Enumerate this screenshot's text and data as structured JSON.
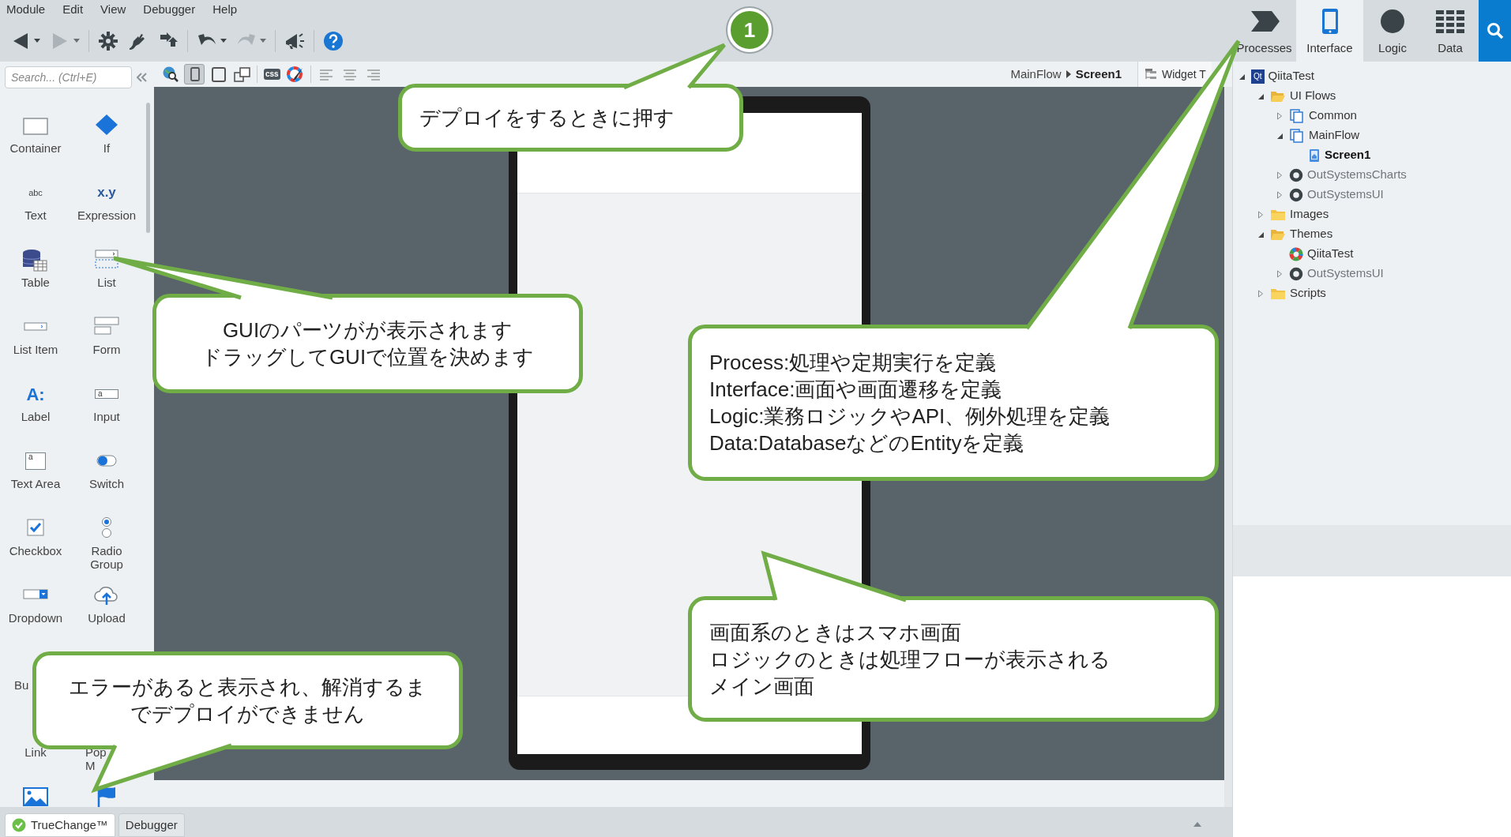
{
  "menu": [
    "Module",
    "Edit",
    "View",
    "Debugger",
    "Help"
  ],
  "toolbar": [
    {
      "kind": "back",
      "caret": true,
      "disabled": false
    },
    {
      "kind": "forward",
      "caret": true,
      "disabled": true
    },
    {
      "kind": "settings",
      "caret": false,
      "disabled": false
    },
    {
      "kind": "plug",
      "caret": false,
      "disabled": false
    },
    {
      "kind": "publish",
      "caret": false,
      "disabled": false
    },
    {
      "kind": "undo",
      "caret": true,
      "disabled": false
    },
    {
      "kind": "redo",
      "caret": true,
      "disabled": true
    },
    {
      "kind": "megaphone",
      "caret": false,
      "disabled": false
    },
    {
      "kind": "help",
      "caret": false,
      "disabled": false
    }
  ],
  "app_tabs": [
    {
      "kind": "processes",
      "label": "Processes",
      "selected": false
    },
    {
      "kind": "interface",
      "label": "Interface",
      "selected": true
    },
    {
      "kind": "logic",
      "label": "Logic",
      "selected": false
    },
    {
      "kind": "data",
      "label": "Data",
      "selected": false
    }
  ],
  "search": {
    "placeholder": "Search... (Ctrl+E)"
  },
  "palette": [
    {
      "kind": "container",
      "label": "Container"
    },
    {
      "kind": "if",
      "label": "If"
    },
    {
      "kind": "text",
      "label": "Text",
      "glyph": "abc"
    },
    {
      "kind": "expression",
      "label": "Expression",
      "glyph": "x.y"
    },
    {
      "kind": "table",
      "label": "Table"
    },
    {
      "kind": "list",
      "label": "List"
    },
    {
      "kind": "list-item",
      "label": "List Item"
    },
    {
      "kind": "form",
      "label": "Form"
    },
    {
      "kind": "label",
      "label": "Label",
      "glyph": "A:"
    },
    {
      "kind": "input",
      "label": "Input",
      "glyph": "a"
    },
    {
      "kind": "text-area",
      "label": "Text Area",
      "glyph": "a"
    },
    {
      "kind": "switch",
      "label": "Switch"
    },
    {
      "kind": "checkbox",
      "label": "Checkbox"
    },
    {
      "kind": "radio-group",
      "label": "Radio\nGroup"
    },
    {
      "kind": "dropdown",
      "label": "Dropdown"
    },
    {
      "kind": "upload",
      "label": "Upload"
    },
    {
      "kind": "covered",
      "label": "Bu",
      "cut": true
    },
    {
      "kind": "covered"
    },
    {
      "kind": "covered",
      "label": "Link",
      "cut": false
    },
    {
      "kind": "covered",
      "label": "Pop\nM",
      "cut": true
    },
    {
      "kind": "image"
    },
    {
      "kind": "flag"
    }
  ],
  "canvas_toolbar": [
    {
      "kind": "preview",
      "selected": false
    },
    {
      "kind": "phone",
      "selected": true
    },
    {
      "kind": "tablet",
      "selected": false
    },
    {
      "kind": "rotate",
      "selected": false
    },
    {
      "kind": "css",
      "glyph": "css",
      "selected": false
    },
    {
      "kind": "theme",
      "selected": false
    },
    {
      "kind": "align-left",
      "selected": false
    },
    {
      "kind": "align-center",
      "selected": false
    },
    {
      "kind": "align-right",
      "selected": false
    }
  ],
  "breadcrumb": [
    "MainFlow",
    "Screen1"
  ],
  "widget_tree_tab": {
    "label": "Widget T"
  },
  "tree": [
    {
      "kind": "app",
      "glyph": "Qt",
      "label": "QiitaTest",
      "selected": false,
      "expanded": true,
      "children": [
        {
          "kind": "folder",
          "label": "UI Flows",
          "selected": false,
          "expanded": true,
          "children": [
            {
              "kind": "flow",
              "label": "Common",
              "selected": false,
              "expanded": false
            },
            {
              "kind": "flow",
              "label": "MainFlow",
              "selected": false,
              "expanded": true,
              "children": [
                {
                  "kind": "screen",
                  "label": "Screen1",
                  "selected": true
                }
              ]
            },
            {
              "kind": "module",
              "label": "OutSystemsCharts",
              "selected": false,
              "expanded": false
            },
            {
              "kind": "module",
              "label": "OutSystemsUI",
              "selected": false,
              "expanded": false
            }
          ]
        },
        {
          "kind": "folder",
          "label": "Images",
          "selected": false,
          "expanded": false
        },
        {
          "kind": "folder",
          "label": "Themes",
          "selected": false,
          "expanded": true,
          "children": [
            {
              "kind": "theme",
              "label": "QiitaTest",
              "selected": false
            },
            {
              "kind": "module",
              "label": "OutSystemsUI",
              "selected": false,
              "expanded": false
            }
          ]
        },
        {
          "kind": "folder",
          "label": "Scripts",
          "selected": false,
          "expanded": false
        }
      ]
    }
  ],
  "bottom_tabs": [
    {
      "kind": "truechange",
      "label": "TrueChange™",
      "selected": true
    },
    {
      "kind": "debugger",
      "label": "Debugger",
      "selected": false
    }
  ],
  "annotations": {
    "badge": "1",
    "callouts": [
      {
        "lines": [
          "デプロイをするときに押す"
        ]
      },
      {
        "lines": [
          "GUIのパーツがが表示されます",
          "ドラッグしてGUIで位置を決めます"
        ]
      },
      {
        "lines": [
          "Process:処理や定期実行を定義",
          "Interface:画面や画面遷移を定義",
          "Logic:業務ロジックやAPI、例外処理を定義",
          "Data:DatabaseなどのEntityを定義"
        ]
      },
      {
        "lines": [
          "画面系のときはスマホ画面",
          "ロジックのときは処理フローが表示される",
          "メイン画面"
        ]
      },
      {
        "lines": [
          "エラーがあると表示され、解消するま",
          "でデプロイができません"
        ]
      }
    ]
  }
}
